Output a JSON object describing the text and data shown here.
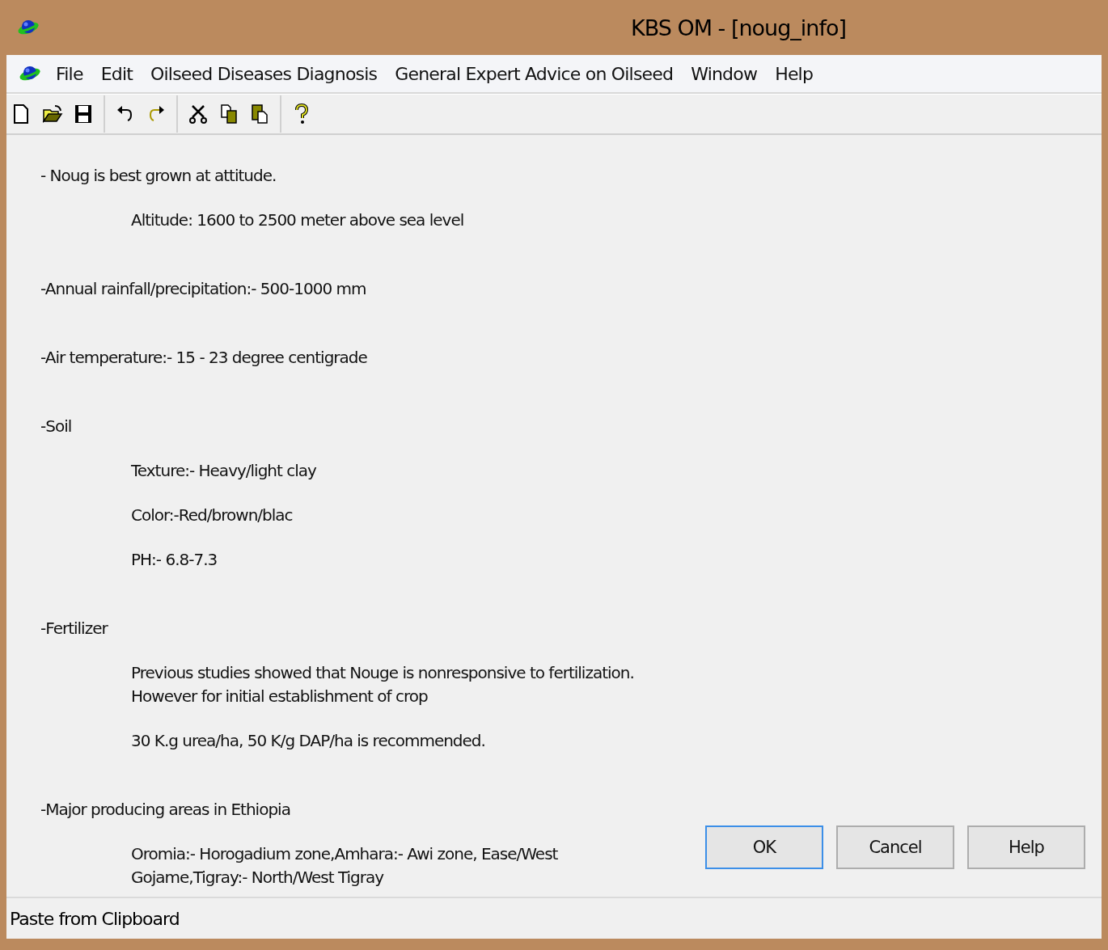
{
  "window": {
    "title": "KBS OM - [noug_info]"
  },
  "menu": [
    "File",
    "Edit",
    "Oilseed Diseases Diagnosis",
    "General Expert Advice on Oilseed",
    "Window",
    "Help"
  ],
  "toolbar": [
    {
      "kind": "new"
    },
    {
      "kind": "open"
    },
    {
      "kind": "save"
    },
    {
      "kind": "sep"
    },
    {
      "kind": "undo"
    },
    {
      "kind": "redo"
    },
    {
      "kind": "sep"
    },
    {
      "kind": "cut"
    },
    {
      "kind": "copy"
    },
    {
      "kind": "paste"
    },
    {
      "kind": "sep"
    },
    {
      "kind": "help"
    }
  ],
  "content": [
    {
      "kind": "heading",
      "lines": [
        "- Noug is best grown at attitude."
      ]
    },
    {
      "kind": "detail",
      "lines": [
        "Altitude:  1600 to 2500  meter above sea level"
      ]
    },
    {
      "kind": "heading",
      "lines": [
        "-Annual rainfall/precipitation:- 500-1000 mm"
      ]
    },
    {
      "kind": "heading",
      "lines": [
        "-Air temperature:- 15 - 23 degree centigrade"
      ]
    },
    {
      "kind": "heading",
      "lines": [
        "-Soil"
      ]
    },
    {
      "kind": "detail",
      "lines": [
        "Texture:- Heavy/light clay"
      ]
    },
    {
      "kind": "detail",
      "lines": [
        "Color:-Red/brown/blac"
      ]
    },
    {
      "kind": "detail",
      "lines": [
        "PH:- 6.8-7.3"
      ]
    },
    {
      "kind": "heading",
      "lines": [
        "-Fertilizer"
      ]
    },
    {
      "kind": "detail",
      "lines": [
        "Previous studies showed that Nouge is nonresponsive to fertilization.",
        "However for initial establishment of crop"
      ]
    },
    {
      "kind": "detail",
      "lines": [
        "30 K.g urea/ha,  50 K/g DAP/ha is recommended."
      ]
    },
    {
      "kind": "heading",
      "lines": [
        "-Major producing areas in Ethiopia"
      ]
    },
    {
      "kind": "detail",
      "lines": [
        "Oromia:- Horogadium zone,Amhara:- Awi zone, Ease/West",
        "Gojame,Tigray:- North/West Tigray"
      ]
    }
  ],
  "buttons": [
    {
      "label": "OK",
      "focused": true
    },
    {
      "label": "Cancel",
      "focused": false
    },
    {
      "label": "Help",
      "focused": false
    }
  ],
  "status_bar": "Paste from Clipboard"
}
